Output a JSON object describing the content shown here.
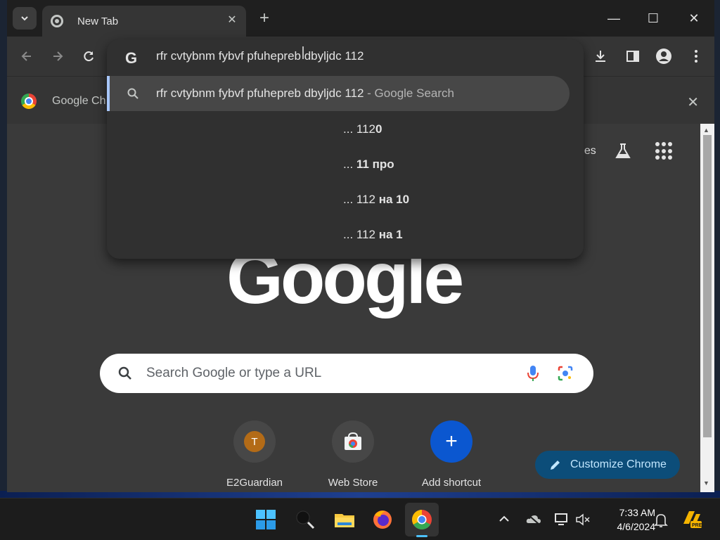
{
  "window": {
    "tab_title": "New Tab",
    "controls": {
      "minimize": "—",
      "maximize": "☐",
      "close": "✕"
    }
  },
  "bookmark_bar": {
    "item_label": "Google Ch"
  },
  "omnibox": {
    "input_text": "rfr cvtybnm fybvf pfuhepreb dbyljdc 112",
    "selected_suggestion": {
      "text": "rfr cvtybnm fybvf pfuhepreb dbyljdc 112",
      "suffix": " - Google Search"
    },
    "tail_suggestions": [
      {
        "prefix": "... 112",
        "bold": "0"
      },
      {
        "prefix": "... ",
        "bold": "11 про"
      },
      {
        "prefix": "... 112 ",
        "bold": "на 10"
      },
      {
        "prefix": "... 112 ",
        "bold": "на 1"
      }
    ]
  },
  "ntp": {
    "images_link": "ges",
    "logo_text": "Google",
    "search_placeholder": "Search Google or type a URL",
    "shortcuts": [
      {
        "label": "E2Guardian",
        "avatar_letter": "T"
      },
      {
        "label": "Web Store"
      },
      {
        "label": "Add shortcut",
        "symbol": "+"
      }
    ],
    "customize_label": "Customize Chrome"
  },
  "taskbar": {
    "time": "7:33 AM",
    "date": "4/6/2024"
  },
  "colors": {
    "accent_blue": "#0b57d0",
    "customize_bg": "#0c4d79",
    "selected_row": "#474747"
  }
}
